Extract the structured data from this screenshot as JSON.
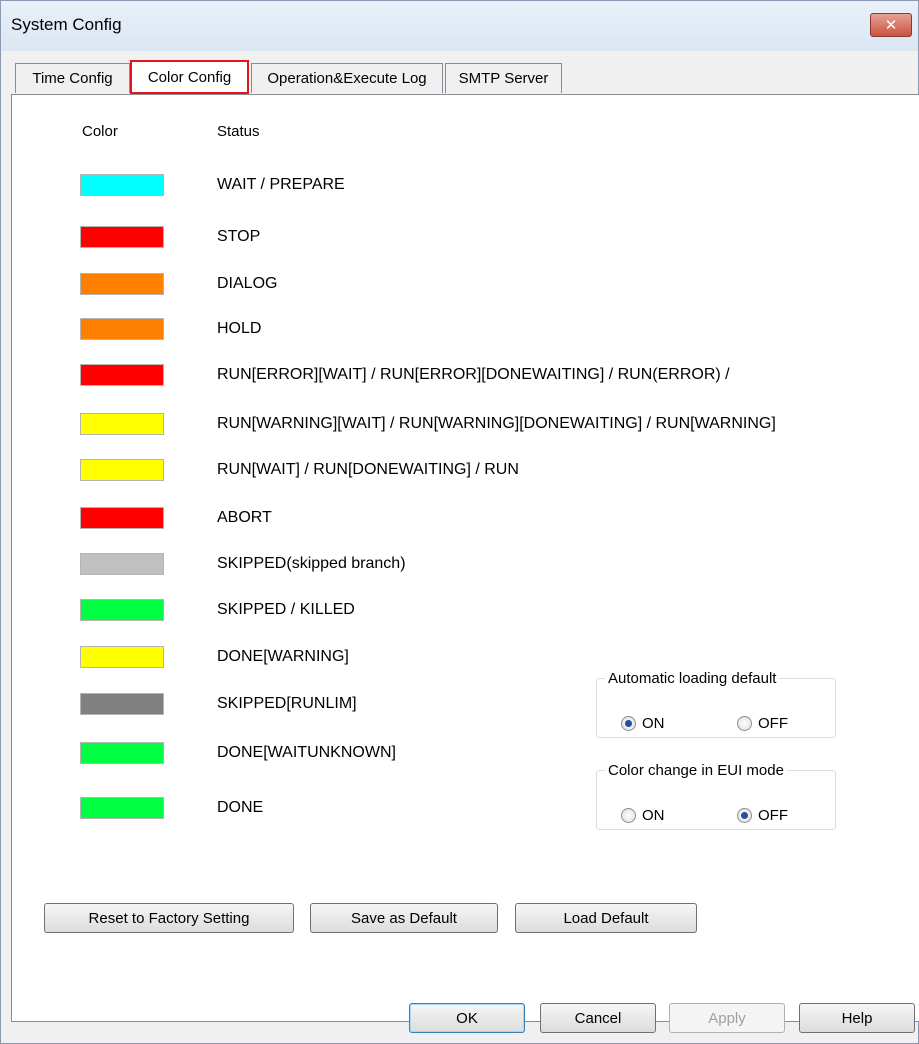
{
  "window": {
    "title": "System Config",
    "close_glyph": "✕"
  },
  "tabs": [
    {
      "label": "Time Config",
      "active": false
    },
    {
      "label": "Color Config",
      "active": true
    },
    {
      "label": "Operation&Execute Log",
      "active": false
    },
    {
      "label": "SMTP Server",
      "active": false
    }
  ],
  "headers": {
    "color": "Color",
    "status": "Status"
  },
  "statuses": [
    {
      "color": "#00ffff",
      "label": "WAIT / PREPARE"
    },
    {
      "color": "#ff0000",
      "label": "STOP"
    },
    {
      "color": "#ff8000",
      "label": "DIALOG"
    },
    {
      "color": "#ff8000",
      "label": "HOLD"
    },
    {
      "color": "#ff0000",
      "label": "RUN[ERROR][WAIT] / RUN[ERROR][DONEWAITING] / RUN(ERROR) /"
    },
    {
      "color": "#ffff00",
      "label": "RUN[WARNING][WAIT] / RUN[WARNING][DONEWAITING] / RUN[WARNING]"
    },
    {
      "color": "#ffff00",
      "label": "RUN[WAIT] / RUN[DONEWAITING] / RUN"
    },
    {
      "color": "#ff0000",
      "label": "ABORT"
    },
    {
      "color": "#c0c0c0",
      "label": "SKIPPED(skipped branch)"
    },
    {
      "color": "#00ff40",
      "label": "SKIPPED / KILLED"
    },
    {
      "color": "#ffff00",
      "label": "DONE[WARNING]"
    },
    {
      "color": "#808080",
      "label": "SKIPPED[RUNLIM]"
    },
    {
      "color": "#00ff40",
      "label": "DONE[WAITUNKNOWN]"
    },
    {
      "color": "#00ff40",
      "label": "DONE"
    }
  ],
  "auto_loading": {
    "legend": "Automatic loading default",
    "on_label": "ON",
    "off_label": "OFF",
    "selected": "ON"
  },
  "eui_color_change": {
    "legend": "Color change in EUI mode",
    "on_label": "ON",
    "off_label": "OFF",
    "selected": "OFF"
  },
  "actions": {
    "reset": "Reset to Factory Setting",
    "save_default": "Save as Default",
    "load_default": "Load Default"
  },
  "dialog_buttons": {
    "ok": "OK",
    "cancel": "Cancel",
    "apply": "Apply",
    "help": "Help"
  }
}
